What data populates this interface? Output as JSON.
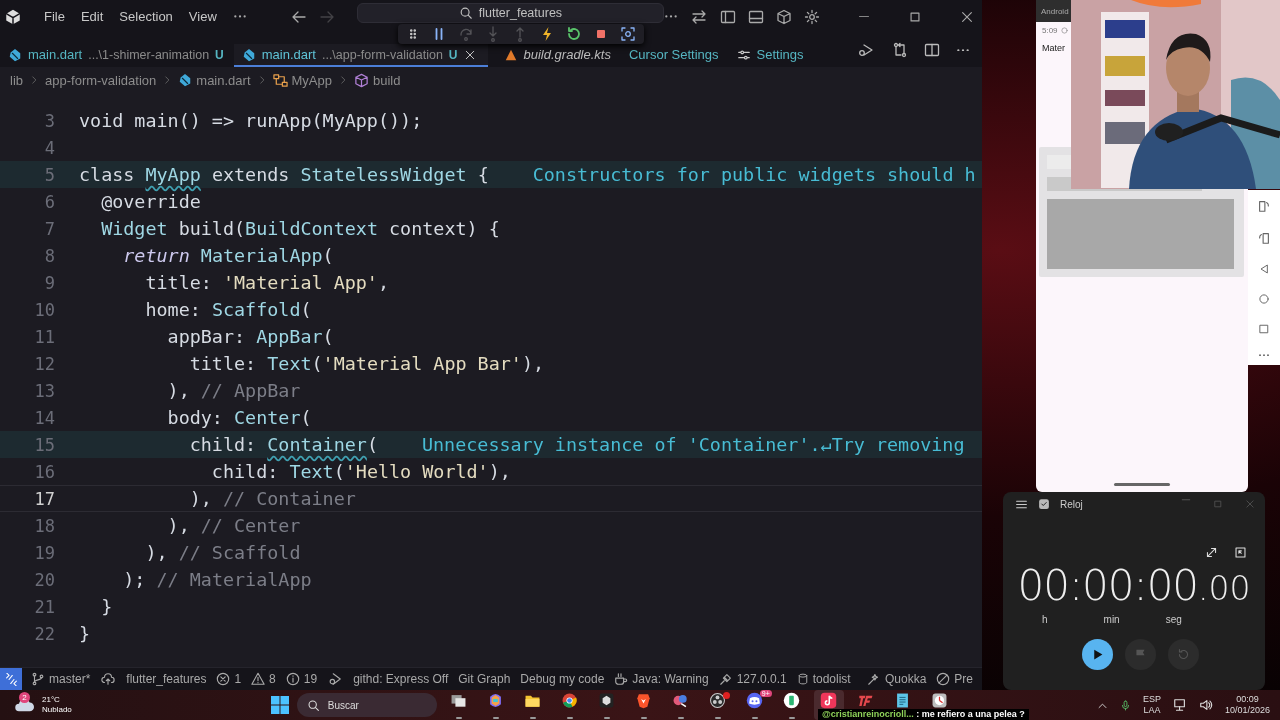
{
  "title_bar": {
    "menu": [
      "File",
      "Edit",
      "Selection",
      "View"
    ],
    "search": {
      "value": "flutter_features"
    }
  },
  "debug_toolbar": [
    {
      "kind": "drag",
      "disabled": false
    },
    {
      "kind": "pause",
      "disabled": false
    },
    {
      "kind": "step-over",
      "disabled": true
    },
    {
      "kind": "step-into",
      "disabled": true
    },
    {
      "kind": "step-out",
      "disabled": true
    },
    {
      "kind": "hot-reload",
      "disabled": false
    },
    {
      "kind": "restart",
      "disabled": false
    },
    {
      "kind": "stop",
      "disabled": false
    },
    {
      "kind": "inspect",
      "disabled": false
    }
  ],
  "tabs": [
    {
      "kind": "dart",
      "name": "main.dart",
      "path": "...\\1-shimer-animation",
      "badge": "U",
      "selected": false,
      "preview": false
    },
    {
      "kind": "dart",
      "name": "main.dart",
      "path": "...\\app-form-validation",
      "badge": "U",
      "selected": true,
      "preview": false
    },
    {
      "kind": "gradle",
      "name": "build.gradle.kts",
      "selected": false,
      "preview": true
    },
    {
      "kind": "plain",
      "name": "Cursor Settings",
      "selected": false,
      "preview": false
    },
    {
      "kind": "settings",
      "name": "Settings",
      "selected": false,
      "preview": false
    }
  ],
  "breadcrumbs": [
    {
      "kind": "folder",
      "label": "lib"
    },
    {
      "kind": "folder",
      "label": "app-form-validation"
    },
    {
      "kind": "dart",
      "label": "main.dart"
    },
    {
      "kind": "class",
      "label": "MyApp"
    },
    {
      "kind": "method",
      "label": "build"
    }
  ],
  "editor": {
    "lines": [
      {
        "number": "3",
        "current": false,
        "tokens": [
          {
            "kind": "plain",
            "text": "void main() => runApp(MyApp());"
          }
        ]
      },
      {
        "number": "4",
        "current": false
      },
      {
        "number": "5",
        "current": false,
        "hint": "Constructors for public widgets should h",
        "tokens": [
          {
            "kind": "plain",
            "text": "class "
          },
          {
            "kind": "warn",
            "text": "MyApp"
          },
          {
            "kind": "plain",
            "text": " extends "
          },
          {
            "kind": "type",
            "text": "StatelessWidget"
          },
          {
            "kind": "plain",
            "text": " {"
          }
        ]
      },
      {
        "number": "6",
        "current": false,
        "tokens": [
          {
            "kind": "plain",
            "text": "  @override"
          }
        ]
      },
      {
        "number": "7",
        "current": false,
        "tokens": [
          {
            "kind": "type",
            "text": "  Widget"
          },
          {
            "kind": "plain",
            "text": " build("
          },
          {
            "kind": "type",
            "text": "BuildContext"
          },
          {
            "kind": "plain",
            "text": " context) {"
          }
        ]
      },
      {
        "number": "8",
        "current": false,
        "tokens": [
          {
            "kind": "keyword",
            "text": "    return"
          },
          {
            "kind": "type",
            "text": " MaterialApp"
          },
          {
            "kind": "plain",
            "text": "("
          }
        ]
      },
      {
        "number": "9",
        "current": false,
        "tokens": [
          {
            "kind": "plain",
            "text": "      title: "
          },
          {
            "kind": "string",
            "text": "'Material App'"
          },
          {
            "kind": "plain",
            "text": ","
          }
        ]
      },
      {
        "number": "10",
        "current": false,
        "tokens": [
          {
            "kind": "plain",
            "text": "      home: "
          },
          {
            "kind": "type",
            "text": "Scaffold"
          },
          {
            "kind": "plain",
            "text": "("
          }
        ]
      },
      {
        "number": "11",
        "current": false,
        "tokens": [
          {
            "kind": "plain",
            "text": "        appBar: "
          },
          {
            "kind": "type",
            "text": "AppBar"
          },
          {
            "kind": "plain",
            "text": "("
          }
        ]
      },
      {
        "number": "12",
        "current": false,
        "tokens": [
          {
            "kind": "plain",
            "text": "          title: "
          },
          {
            "kind": "type",
            "text": "Text"
          },
          {
            "kind": "plain",
            "text": "("
          },
          {
            "kind": "string",
            "text": "'Material App Bar'"
          },
          {
            "kind": "plain",
            "text": "),"
          }
        ]
      },
      {
        "number": "13",
        "current": false,
        "tokens": [
          {
            "kind": "plain",
            "text": "        ), "
          },
          {
            "kind": "comment",
            "text": "// AppBar"
          }
        ]
      },
      {
        "number": "14",
        "current": false,
        "tokens": [
          {
            "kind": "plain",
            "text": "        body: "
          },
          {
            "kind": "type",
            "text": "Center"
          },
          {
            "kind": "plain",
            "text": "("
          }
        ]
      },
      {
        "number": "15",
        "current": false,
        "hint": "Unnecessary instance of 'Container'.↵Try removing",
        "tokens": [
          {
            "kind": "plain",
            "text": "          child: "
          },
          {
            "kind": "warn",
            "text": "Container"
          },
          {
            "kind": "plain",
            "text": "("
          }
        ]
      },
      {
        "number": "16",
        "current": false,
        "tokens": [
          {
            "kind": "plain",
            "text": "            child: "
          },
          {
            "kind": "type",
            "text": "Text"
          },
          {
            "kind": "plain",
            "text": "("
          },
          {
            "kind": "string",
            "text": "'Hello World'"
          },
          {
            "kind": "plain",
            "text": "),"
          }
        ]
      },
      {
        "number": "17",
        "current": true,
        "tokens": [
          {
            "kind": "plain",
            "text": "          ), "
          },
          {
            "kind": "comment",
            "text": "// Container"
          }
        ]
      },
      {
        "number": "18",
        "current": false,
        "tokens": [
          {
            "kind": "plain",
            "text": "        ), "
          },
          {
            "kind": "comment",
            "text": "// Center"
          }
        ]
      },
      {
        "number": "19",
        "current": false,
        "tokens": [
          {
            "kind": "plain",
            "text": "      ), "
          },
          {
            "kind": "comment",
            "text": "// Scaffold"
          }
        ]
      },
      {
        "number": "20",
        "current": false,
        "tokens": [
          {
            "kind": "plain",
            "text": "    ); "
          },
          {
            "kind": "comment",
            "text": "// MaterialApp"
          }
        ]
      },
      {
        "number": "21",
        "current": false,
        "tokens": [
          {
            "kind": "plain",
            "text": "  }"
          }
        ]
      },
      {
        "number": "22",
        "current": false,
        "tokens": [
          {
            "kind": "plain",
            "text": "}"
          }
        ]
      }
    ]
  },
  "status_bar": {
    "left": [
      {
        "kind": "remote"
      },
      {
        "kind": "branch",
        "text": "master*"
      },
      {
        "kind": "cloud"
      },
      {
        "kind": "plain",
        "text": "flutter_features"
      },
      {
        "kind": "error",
        "text": "1"
      },
      {
        "kind": "warning",
        "text": "8"
      },
      {
        "kind": "info",
        "text": "19"
      },
      {
        "kind": "debug"
      },
      {
        "kind": "plain",
        "text": "githd: Express Off"
      },
      {
        "kind": "plain",
        "text": "Git Graph"
      },
      {
        "kind": "plain",
        "text": "Debug my code"
      },
      {
        "kind": "java",
        "text": "Java: Warning"
      },
      {
        "kind": "plug",
        "text": "127.0.0.1"
      },
      {
        "kind": "database",
        "text": "todolist"
      }
    ],
    "right": [
      {
        "kind": "quokka",
        "text": "Quokka"
      },
      {
        "kind": "blocked",
        "text": "Pre"
      }
    ]
  },
  "emulator": {
    "title": "Android",
    "time": "5:09",
    "app_title": "Mater"
  },
  "clock": {
    "title": "Reloj",
    "time": "00:00:00",
    "fraction": ".00",
    "units": [
      "h",
      "min",
      "seg"
    ],
    "buttons": [
      {
        "kind": "play",
        "disabled": false
      },
      {
        "kind": "flag",
        "disabled": true
      },
      {
        "kind": "reset",
        "disabled": true
      }
    ]
  },
  "taskbar": {
    "weather": {
      "badge": "2",
      "temp": "21°C",
      "desc": "Nublado"
    },
    "search": {
      "placeholder": "Buscar"
    },
    "apps": [
      {
        "kind": "taskview",
        "active": false,
        "alert": false
      },
      {
        "kind": "copilot",
        "active": false,
        "alert": false
      },
      {
        "kind": "folder",
        "active": false,
        "alert": false
      },
      {
        "kind": "chrome",
        "active": false,
        "alert": false
      },
      {
        "kind": "cube",
        "active": false,
        "alert": false
      },
      {
        "kind": "brave",
        "active": false,
        "alert": false
      },
      {
        "kind": "bird",
        "active": false,
        "alert": false
      },
      {
        "kind": "obs",
        "active": false,
        "alert": true
      },
      {
        "kind": "discord",
        "active": false,
        "alert": false,
        "badge": "9+"
      },
      {
        "kind": "phone",
        "active": false,
        "alert": false
      },
      {
        "kind": "tiktok",
        "active": true,
        "alert": false
      },
      {
        "kind": "tf",
        "active": false,
        "alert": false
      },
      {
        "kind": "notepad",
        "active": false,
        "alert": false
      },
      {
        "kind": "clock",
        "active": false,
        "alert": false
      }
    ],
    "lang": "ESP",
    "layout": "LAA",
    "time": "00:09",
    "date": "10/01/2026"
  },
  "chat_overlay": {
    "user": "@cristianreinocrioll...",
    "message": ": me refiero a una pelea ?"
  }
}
